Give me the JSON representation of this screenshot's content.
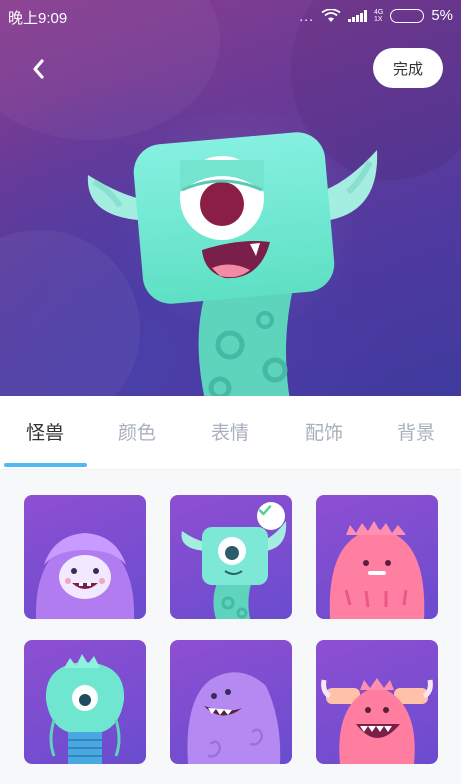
{
  "status_bar": {
    "time": "晚上9:09",
    "dots": "...",
    "net_top": "4G",
    "net_bottom": "1X",
    "battery": "5%"
  },
  "header": {
    "back_icon": "chevron-left-icon",
    "done_label": "完成"
  },
  "tabs": [
    {
      "label": "怪兽",
      "active": true
    },
    {
      "label": "颜色",
      "active": false
    },
    {
      "label": "表情",
      "active": false
    },
    {
      "label": "配饰",
      "active": false
    },
    {
      "label": "背景",
      "active": false
    }
  ],
  "monsters": [
    {
      "name": "furry-purple-monster",
      "selected": false
    },
    {
      "name": "cyclops-teal-monster",
      "selected": true
    },
    {
      "name": "pink-fluffy-monster",
      "selected": false
    },
    {
      "name": "teal-balloon-monster",
      "selected": false
    },
    {
      "name": "purple-dino-monster",
      "selected": false
    },
    {
      "name": "pink-horned-monster",
      "selected": false
    }
  ],
  "colors": {
    "accent": "#4fb9f0",
    "hero_bg": "#5b3a9e",
    "monster_teal": "#6fe6d0"
  }
}
